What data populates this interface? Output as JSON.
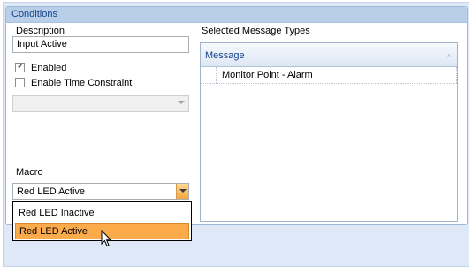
{
  "groupbox": {
    "title": "Conditions"
  },
  "description": {
    "label": "Description",
    "value": "Input Active"
  },
  "enabled": {
    "label": "Enabled",
    "checked": true
  },
  "time_constraint": {
    "label": "Enable Time Constraint",
    "checked": false
  },
  "constraint_combo": {
    "value": ""
  },
  "macro": {
    "label": "Macro",
    "value": "Red LED Active",
    "options": [
      {
        "label": "Red LED Inactive",
        "selected": false
      },
      {
        "label": "Red LED Active",
        "selected": true
      }
    ]
  },
  "messages": {
    "label": "Selected Message Types",
    "column_header": "Message",
    "rows": [
      "Monitor Point - Alarm"
    ]
  },
  "colors": {
    "header_bg": "#b9cfe9",
    "title_text": "#15428b",
    "highlight": "#fbab4a"
  },
  "icons": {
    "sort": "sort-indicator-icon",
    "cursor": "mouse-pointer-icon",
    "check": "check-mark-icon",
    "combo_arrow": "chevron-down-icon"
  }
}
